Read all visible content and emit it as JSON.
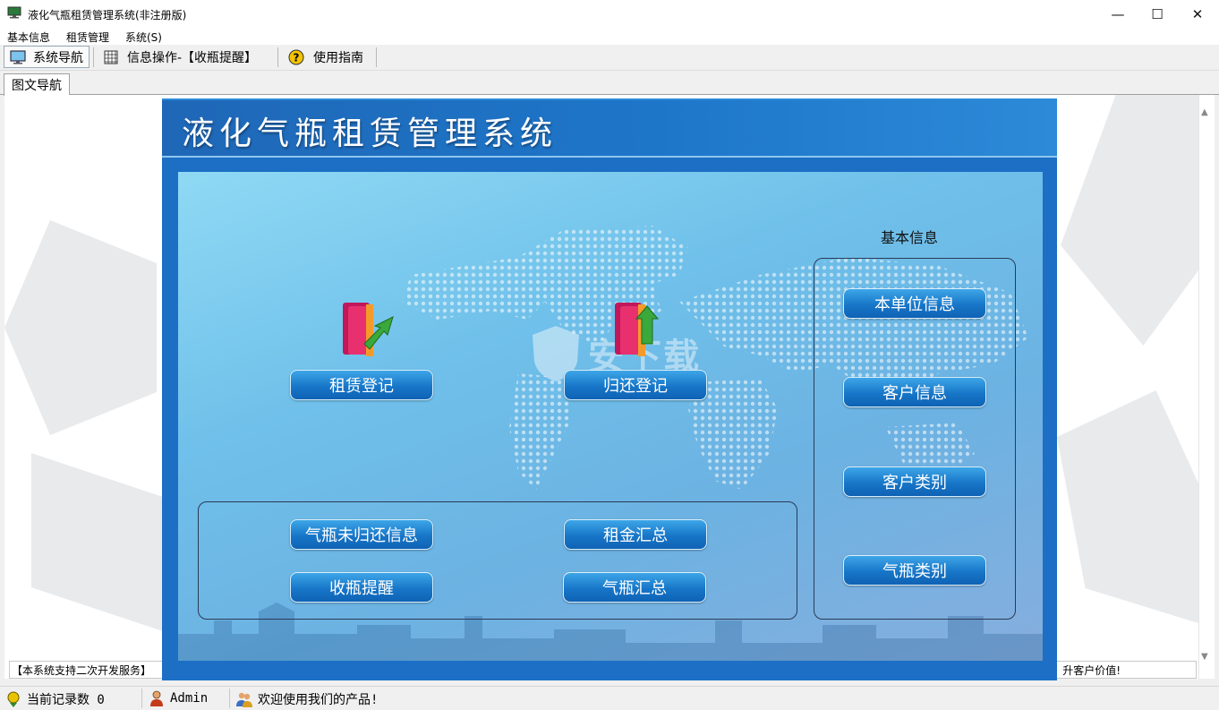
{
  "window": {
    "title": "液化气瓶租赁管理系统(非注册版)",
    "minimize_glyph": "—",
    "maximize_glyph": "☐",
    "close_glyph": "✕"
  },
  "menu": [
    "基本信息",
    "租赁管理",
    "系统(S)"
  ],
  "toolbar": {
    "nav_label": "系统导航",
    "info_label": "信息操作-【收瓶提醒】",
    "guide_label": "使用指南"
  },
  "tab": {
    "label": "图文导航"
  },
  "panel": {
    "title": "液化气瓶租赁管理系统",
    "rent_register": "租赁登记",
    "return_register": "归还登记",
    "group_bottom": {
      "unreturned": "气瓶未归还信息",
      "rent_summary": "租金汇总",
      "collect_reminder": "收瓶提醒",
      "cylinder_summary": "气瓶汇总"
    },
    "basic_info": {
      "label": "基本信息",
      "unit_info": "本单位信息",
      "customer_info": "客户信息",
      "customer_type": "客户类别",
      "cylinder_type": "气瓶类别"
    },
    "watermark": "安下载"
  },
  "ticker": {
    "left": "【本系统支持二次开发服务】",
    "right": "升客户价值!"
  },
  "status": {
    "record_count": "当前记录数 0",
    "user": "Admin",
    "welcome": "欢迎使用我们的产品!"
  },
  "colors": {
    "panel_blue": "#1c6fc4",
    "button_blue": "#1776c8"
  },
  "icons": [
    "monitor-icon",
    "grid-icon",
    "help-icon",
    "rent-book-icon",
    "return-book-icon",
    "record-count-icon",
    "user-icon",
    "users-icon"
  ]
}
